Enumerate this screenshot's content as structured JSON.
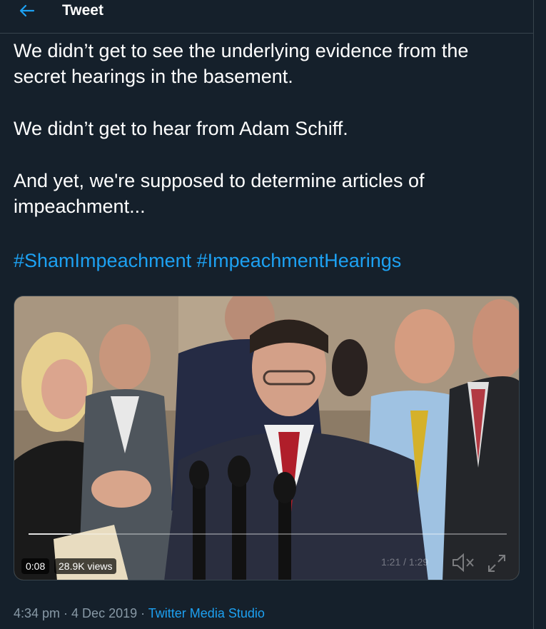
{
  "header": {
    "title": "Tweet"
  },
  "tweet": {
    "paragraphs": [
      "We didn’t get to see the underlying evidence from the secret hearings in the basement.",
      "We didn’t get to hear from Adam Schiff.",
      "And yet, we're supposed to determine articles of impeachment..."
    ],
    "hashtags": [
      "#ShamImpeachment",
      "#ImpeachmentHearings"
    ]
  },
  "video": {
    "elapsed": "0:08",
    "views": "28.9K views",
    "time_total": "1:21 / 1:29",
    "progress_fraction": 0.09
  },
  "meta": {
    "time": "4:34 pm",
    "separator": " · ",
    "date": "4 Dec 2019",
    "source": "Twitter Media Studio"
  },
  "colors": {
    "background": "#15202b",
    "accent": "#1da1f2",
    "secondary_text": "#8899a6",
    "border": "#38444d"
  }
}
